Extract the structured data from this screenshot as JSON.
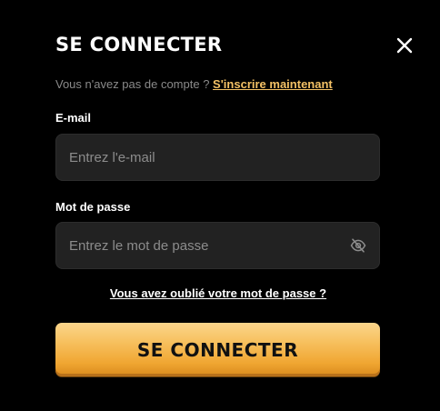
{
  "modal": {
    "title": "SE CONNECTER",
    "close_icon": "close-icon",
    "signup_prompt": "Vous n'avez pas de compte ? ",
    "signup_link": "S'inscrire maintenant",
    "email": {
      "label": "E-mail",
      "placeholder": "Entrez l'e-mail",
      "value": ""
    },
    "password": {
      "label": "Mot de passe",
      "placeholder": "Entrez le mot de passe",
      "value": "",
      "toggle_icon": "eye-off-icon"
    },
    "forgot_link": "Vous avez oublié votre mot de passe ?",
    "submit_label": "SE CONNECTER"
  },
  "colors": {
    "background": "#000000",
    "field_bg": "#222222",
    "accent_link": "#f3c165",
    "button_top": "#fbd58b",
    "button_bottom": "#d98a1c"
  }
}
